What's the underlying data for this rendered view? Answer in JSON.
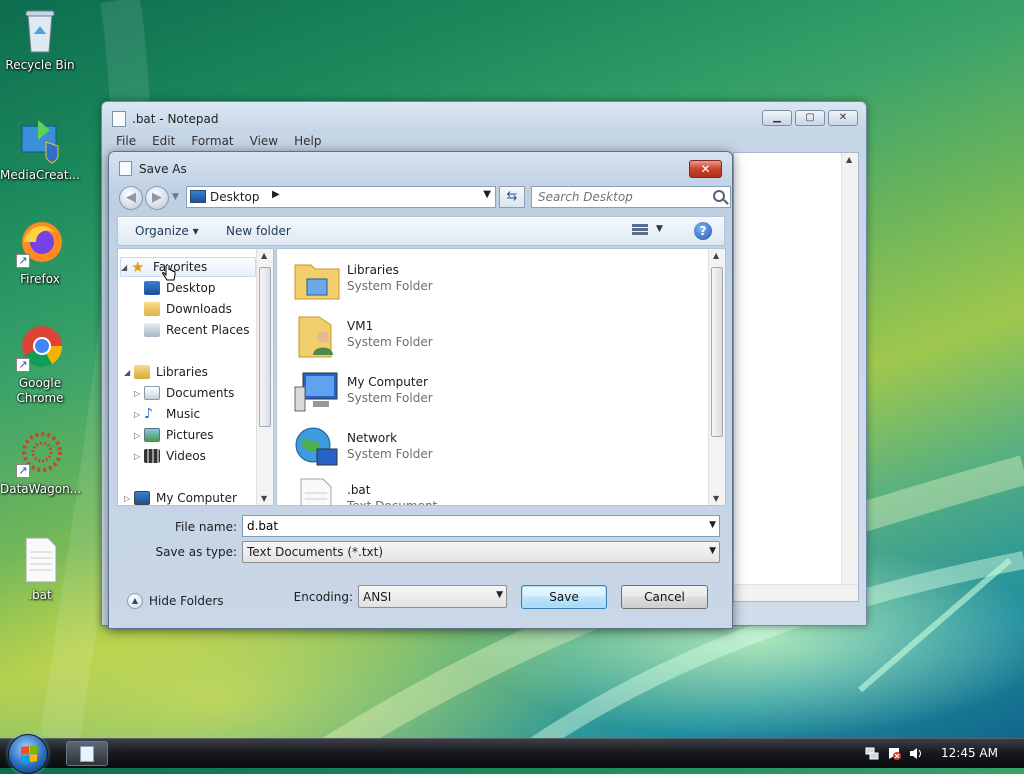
{
  "desktop": {
    "icons": [
      {
        "label": "Recycle Bin"
      },
      {
        "label": "MediaCreat..."
      },
      {
        "label": "Firefox"
      },
      {
        "label": "Google Chrome"
      },
      {
        "label": "DataWagon..."
      },
      {
        "label": ".bat"
      }
    ]
  },
  "notepad": {
    "title": ".bat - Notepad",
    "menu": [
      "File",
      "Edit",
      "Format",
      "View",
      "Help"
    ],
    "buttons": {
      "minimize": "▁",
      "maximize": "▢",
      "close": "✕"
    }
  },
  "dialog": {
    "title": "Save As",
    "close_label": "✕",
    "address": {
      "location": "Desktop",
      "separator": "▶",
      "dropdown": "▼"
    },
    "search": {
      "placeholder": "Search Desktop"
    },
    "toolbar": {
      "organize": "Organize ▾",
      "new_folder": "New folder",
      "views_drop": "▼",
      "help": "?"
    },
    "nav_tree": [
      {
        "label": "Favorites"
      },
      {
        "label": "Desktop"
      },
      {
        "label": "Downloads"
      },
      {
        "label": "Recent Places"
      },
      {
        "label": "Libraries"
      },
      {
        "label": "Documents"
      },
      {
        "label": "Music"
      },
      {
        "label": "Pictures"
      },
      {
        "label": "Videos"
      },
      {
        "label": "My Computer"
      }
    ],
    "files": [
      {
        "name": "Libraries",
        "type": "System Folder"
      },
      {
        "name": "VM1",
        "type": "System Folder"
      },
      {
        "name": "My Computer",
        "type": "System Folder"
      },
      {
        "name": "Network",
        "type": "System Folder"
      },
      {
        "name": ".bat",
        "type": "Text Document"
      }
    ],
    "form": {
      "file_name_label": "File name:",
      "file_name_value": "d.bat",
      "save_type_label": "Save as type:",
      "save_type_value": "Text Documents (*.txt)",
      "encoding_label": "Encoding:",
      "encoding_value": "ANSI",
      "hide_folders": "Hide Folders",
      "save_button": "Save",
      "cancel_button": "Cancel"
    }
  },
  "taskbar": {
    "clock": "12:45 AM"
  },
  "colors": {
    "dialog_frame": "#bfd0e3",
    "close_button": "#c8432d",
    "taskbar": "#16181b"
  }
}
